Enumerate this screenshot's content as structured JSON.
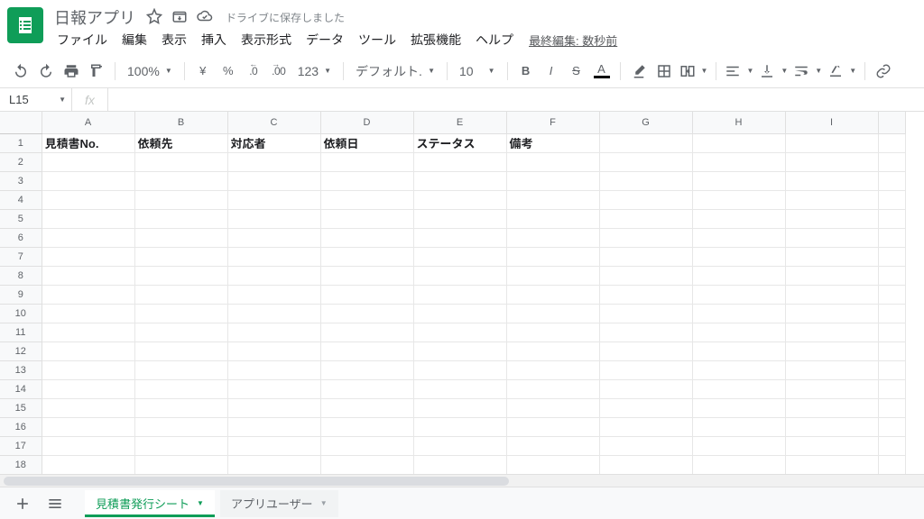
{
  "doc": {
    "title": "日報アプリ",
    "save_status": "ドライブに保存しました"
  },
  "menu": {
    "file": "ファイル",
    "edit": "編集",
    "view": "表示",
    "insert": "挿入",
    "format": "表示形式",
    "data": "データ",
    "tools": "ツール",
    "addons": "拡張機能",
    "help": "ヘルプ",
    "last_edit": "最終編集: 数秒前"
  },
  "toolbar": {
    "zoom": "100%",
    "currency": "¥",
    "percent": "%",
    "dec_dec": ".0",
    "inc_dec": ".00",
    "more_num": "123",
    "font": "デフォルト...",
    "font_size": "10",
    "text_color_letter": "A",
    "link": "⊃"
  },
  "fx": {
    "cell_ref": "L15",
    "fx_label": "fx",
    "formula": ""
  },
  "columns": [
    "A",
    "B",
    "C",
    "D",
    "E",
    "F",
    "G",
    "H",
    "I"
  ],
  "rows": 18,
  "selected_cell": {
    "row": 15,
    "col": 12
  },
  "headers": {
    "A": "見積書No.",
    "B": "依頼先",
    "C": "対応者",
    "D": "依頼日",
    "E": "ステータス",
    "F": "備考"
  },
  "tabs": {
    "active": "見積書発行シート",
    "other": "アプリユーザー"
  }
}
